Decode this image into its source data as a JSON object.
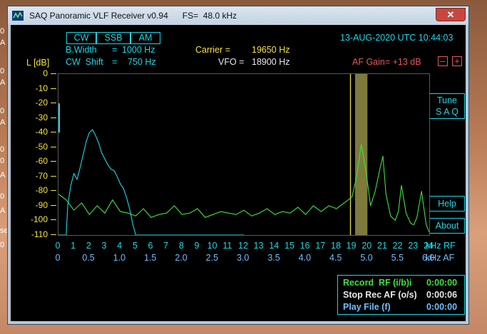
{
  "window": {
    "title": "SAQ Panoramic VLF Receiver v0.94",
    "fs_label": "FS=  48.0 kHz",
    "close_glyph": "✕"
  },
  "desktop": {
    "left_texts": [
      "0",
      "A",
      "0",
      "A",
      "0",
      "A",
      "0",
      "0",
      "A",
      "0",
      "A",
      "se-",
      "0"
    ]
  },
  "modes": [
    "CW",
    "SSB",
    "AM"
  ],
  "datetime": "13-AUG-2020 UTC 10:44:03",
  "bandwidth": {
    "label": "B.Width",
    "eq": "=",
    "value": "1000 Hz"
  },
  "cwshift": {
    "label": "CW  Shift",
    "eq": "=",
    "value": "750 Hz"
  },
  "carrier": {
    "label": "Carrier =",
    "value": "19650 Hz"
  },
  "vfo": {
    "label": "VFO =",
    "value": "18900 Hz"
  },
  "af_gain": {
    "label": "AF Gain= +13 dB",
    "minus": "–",
    "plus": "+"
  },
  "y_axis_title": "L [dB]",
  "buttons": {
    "tune_line1": "Tune",
    "tune_line2": "S A Q",
    "help": "Help",
    "about": "About"
  },
  "record": {
    "line1_label": "Record  RF (i/b)i",
    "line1_time": "0:00:00",
    "line2_label": "Stop Rec AF (o/s)",
    "line2_time": "0:00:06",
    "line3_label": "Play File (f)",
    "line3_time": "0:00:00"
  },
  "colors": {
    "rf_trace": "#3de03d",
    "af_trace": "#19d8e8",
    "passband": "#7d7a3c",
    "tune_marker": "#e8e04a"
  },
  "chart_data": {
    "type": "line",
    "ylabel": "L [dB]",
    "ylim": [
      -110,
      0
    ],
    "yticks": [
      "0",
      "-10",
      "-20",
      "-30",
      "-40",
      "-50",
      "-60",
      "-70",
      "-80",
      "-90",
      "-100",
      "-110"
    ],
    "xlim": [
      0,
      24
    ],
    "xticks_rf": [
      "0",
      "1",
      "2",
      "3",
      "4",
      "5",
      "6",
      "7",
      "8",
      "9",
      "10",
      "11",
      "12",
      "13",
      "14",
      "15",
      "16",
      "17",
      "18",
      "19",
      "20",
      "21",
      "22",
      "23",
      "24"
    ],
    "xaxis_rf_unit": "kHz RF",
    "xticks_af": [
      "0",
      "0.5",
      "1.0",
      "1.5",
      "2.0",
      "2.5",
      "3.0",
      "3.5",
      "4.0",
      "4.5",
      "5.0",
      "5.5",
      "6.0"
    ],
    "xaxis_af_unit": "kHz AF",
    "passband_khz": [
      19.2,
      20.0
    ],
    "marker_khz": 18.9,
    "series": [
      {
        "key": "rf",
        "x": [
          0,
          0.5,
          1,
          1.5,
          2,
          2.5,
          3,
          3.5,
          4,
          4.5,
          5,
          5.5,
          6,
          6.5,
          7,
          7.5,
          8,
          8.5,
          9,
          9.5,
          10,
          10.5,
          11,
          11.5,
          12,
          12.5,
          13,
          13.5,
          14,
          14.5,
          15,
          15.5,
          16,
          16.5,
          17,
          17.5,
          18,
          18.5,
          19,
          19.3,
          19.6,
          19.9,
          20.2,
          20.5,
          20.8,
          21,
          21.2,
          21.5,
          21.8,
          22,
          22.2,
          22.5,
          22.8,
          23,
          23.2,
          23.5,
          23.8,
          24
        ],
        "y": [
          -82,
          -86,
          -93,
          -88,
          -96,
          -90,
          -95,
          -86,
          -94,
          -95,
          -97,
          -92,
          -98,
          -96,
          -95,
          -90,
          -96,
          -95,
          -92,
          -98,
          -96,
          -94,
          -95,
          -96,
          -93,
          -97,
          -95,
          -92,
          -96,
          -94,
          -95,
          -91,
          -96,
          -90,
          -94,
          -90,
          -92,
          -88,
          -84,
          -70,
          -48,
          -66,
          -90,
          -80,
          -65,
          -56,
          -82,
          -97,
          -100,
          -94,
          -76,
          -95,
          -102,
          -103,
          -98,
          -80,
          -103,
          -108
        ]
      },
      {
        "key": "af",
        "x": [
          0,
          0.5,
          0.6,
          0.8,
          1.0,
          1.2,
          1.4,
          1.6,
          1.8,
          2.0,
          2.2,
          2.4,
          2.6,
          2.8,
          3.0,
          3.2,
          3.4,
          3.6,
          3.8,
          4.0,
          4.2,
          4.4,
          4.6,
          4.8,
          5.0,
          5.2,
          5.4,
          5.6,
          5.8,
          6.0,
          12
        ],
        "y": [
          -110,
          -110,
          -90,
          -76,
          -68,
          -72,
          -64,
          -55,
          -46,
          -40,
          -38,
          -42,
          -47,
          -54,
          -58,
          -62,
          -65,
          -66,
          -70,
          -75,
          -78,
          -84,
          -92,
          -102,
          -110,
          -110,
          -110,
          -110,
          -110,
          -110,
          -110
        ]
      }
    ]
  }
}
